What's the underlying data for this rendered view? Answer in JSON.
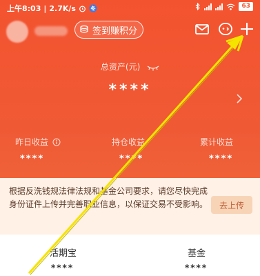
{
  "status_bar": {
    "time": "上午8:03",
    "speed": "2.7K/s",
    "battery": "63"
  },
  "header": {
    "signin_label": "签到赚积分"
  },
  "assets": {
    "label": "总资产(元)",
    "value": "****"
  },
  "income": [
    {
      "label": "昨日收益",
      "value": "****"
    },
    {
      "label": "持仓收益",
      "value": "****"
    },
    {
      "label": "累计收益",
      "value": "****"
    }
  ],
  "notice": {
    "text": "根据反洗钱规法律法规和基金公司要求，请您尽快完成身份证件上传并完善职业信息，以保证交易不受影响。",
    "button_label": "去上传"
  },
  "funds": [
    {
      "name": "活期宝",
      "value": "****"
    },
    {
      "name": "基金",
      "value": "****"
    }
  ],
  "colors": {
    "brand": "#ef5a35",
    "notice_bg": "#fff1e6",
    "arrow": "#f5e300"
  },
  "icons": [
    "alarm-icon",
    "app-badge-icon",
    "bluetooth-icon",
    "signal-icon",
    "wifi-icon",
    "battery-icon",
    "coin-stack-icon",
    "mail-icon",
    "service-face-icon",
    "plus-icon",
    "eye-closed-icon",
    "info-icon",
    "chevron-right-icon",
    "pointer-arrow"
  ]
}
